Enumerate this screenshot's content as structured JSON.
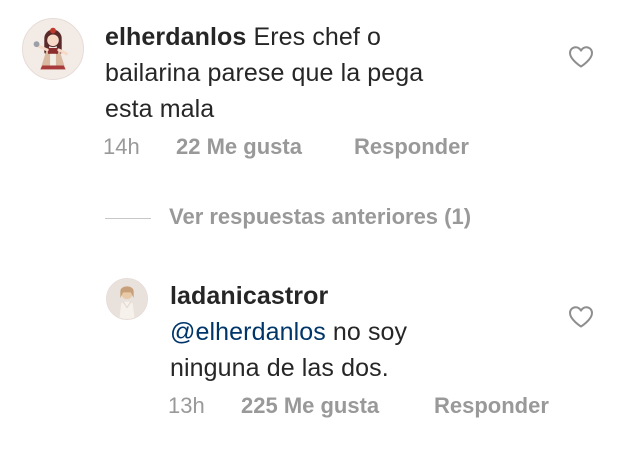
{
  "comments": [
    {
      "username": "elherdanlos",
      "text_lines": [
        "Eres chef o",
        "bailarina parese que la pega",
        "esta mala"
      ],
      "time": "14h",
      "likes": "22 Me gusta",
      "reply": "Responder",
      "heart_icon": "heart-outline-icon"
    },
    {
      "username": "ladanicastror",
      "mention": "@elherdanlos",
      "text_lines": [
        " no soy",
        "ninguna de las dos."
      ],
      "time": "13h",
      "likes": "225 Me gusta",
      "reply": "Responder",
      "heart_icon": "heart-outline-icon"
    }
  ],
  "view_previous_replies": "Ver respuestas anteriores (1)",
  "colors": {
    "text": "#262626",
    "meta": "#999999",
    "mention": "#003569",
    "divider": "#c7c7c7"
  }
}
